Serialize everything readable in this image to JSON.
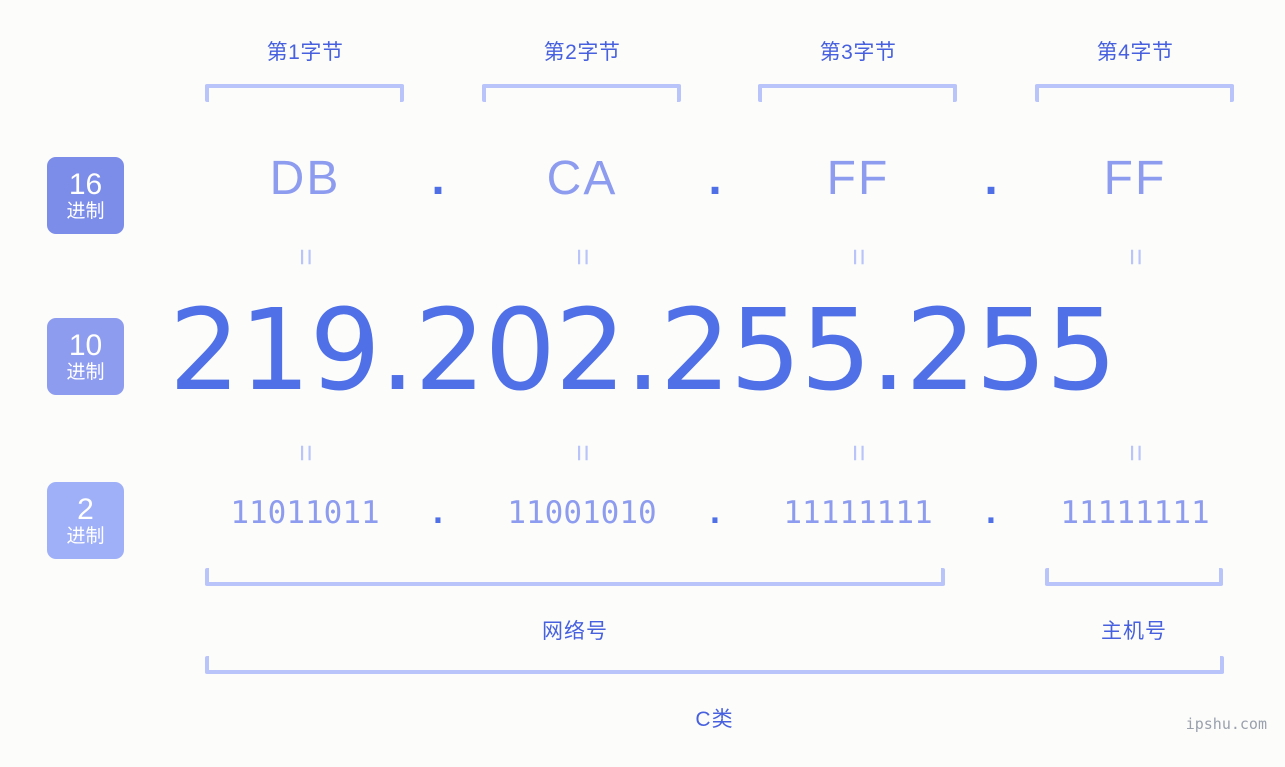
{
  "background_color": "#fcfdfa",
  "accent_colors": {
    "badge_hex": "#7b8ce9",
    "badge_dec": "#8e9cf0",
    "badge_bin": "#9fb0f8",
    "bracket": "#b9c4fa",
    "label_blue": "#4760df",
    "value_light": "#8e9cf0",
    "value_strong": "#5070e8",
    "watermark": "#9aa0ad"
  },
  "radix_badges": [
    {
      "number": "16",
      "unit": "进制"
    },
    {
      "number": "10",
      "unit": "进制"
    },
    {
      "number": "2",
      "unit": "进制"
    }
  ],
  "byte_labels": [
    "第1字节",
    "第2字节",
    "第3字节",
    "第4字节"
  ],
  "separator": ".",
  "equals_glyph": "=",
  "rows": {
    "hex": {
      "values": [
        "DB",
        "CA",
        "FF",
        "FF"
      ]
    },
    "decimal": {
      "values": [
        "219",
        "202",
        "255",
        "255"
      ],
      "full": "219.202.255.255"
    },
    "binary": {
      "values": [
        "11011011",
        "11001010",
        "11111111",
        "11111111"
      ]
    }
  },
  "sections": {
    "network": "网络号",
    "host": "主机号",
    "class": "C类"
  },
  "watermark": "ipshu.com"
}
